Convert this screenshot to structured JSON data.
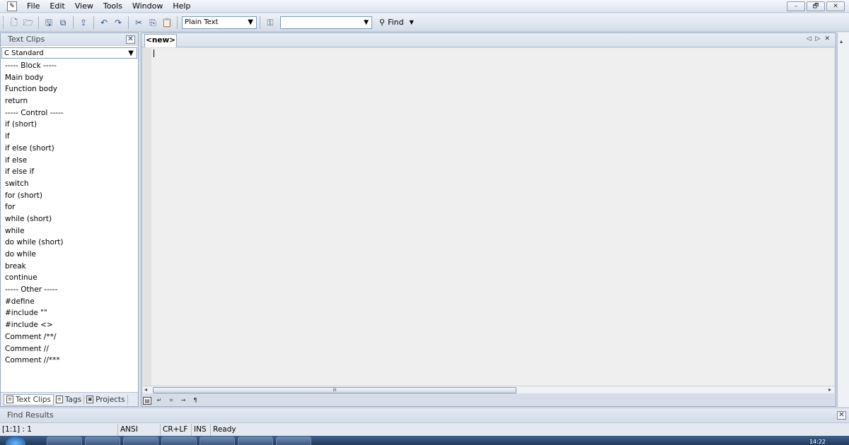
{
  "menubar": {
    "items": [
      "File",
      "Edit",
      "View",
      "Tools",
      "Window",
      "Help"
    ],
    "window_controls": [
      "–",
      "🗗",
      "✕"
    ]
  },
  "toolbar": {
    "language_value": "Plain Text",
    "search_value": "",
    "find_label": "Find"
  },
  "left_panel": {
    "title": "Text Clips",
    "category_value": "C Standard",
    "clips": [
      "----- Block -----",
      "Main body",
      "Function body",
      "return",
      "----- Control -----",
      "if (short)",
      "if",
      "if else (short)",
      "if else",
      "if else if",
      "switch",
      "for (short)",
      "for",
      "while (short)",
      "while",
      "do while (short)",
      "do while",
      "break",
      "continue",
      "----- Other -----",
      "#define",
      "#include \"\"",
      "#include <>",
      "Comment /**/",
      "Comment //",
      "Comment //***"
    ],
    "tabs": [
      "Text Clips",
      "Tags",
      "Projects"
    ]
  },
  "editor": {
    "tab_label": "<new>",
    "scroll_grip": "III"
  },
  "find_results": {
    "title": "Find Results"
  },
  "statusbar": {
    "position": "[1:1] : 1",
    "encoding": "ANSI",
    "line_ending": "CR+LF",
    "mode": "INS",
    "status": "Ready"
  },
  "taskbar": {
    "clock": "14:22"
  },
  "colors": {
    "chrome": "#d9e1ec",
    "editor_background": "#efefef",
    "taskbar": "#233a5b"
  }
}
